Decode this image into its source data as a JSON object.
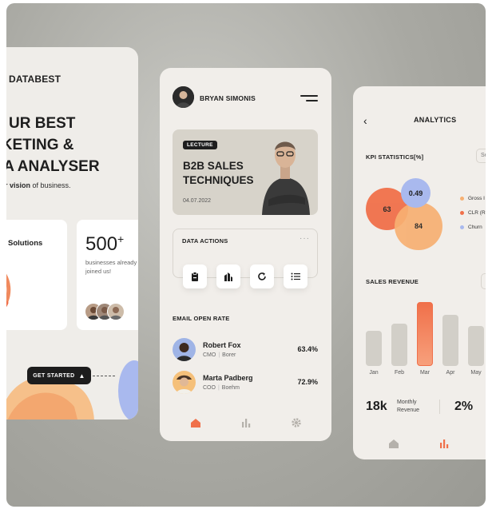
{
  "left": {
    "brand": "DATABEST",
    "headline": [
      "UR BEST",
      "RKETING &",
      "TA ANALYSER"
    ],
    "sub_bold": "ear vision",
    "sub_rest": " of business.",
    "box1_title": "Solutions",
    "count": "500",
    "count_sup": "+",
    "count_sub": "businesses already joined us!",
    "cta": "GET STARTED",
    "colors": {
      "accent": "#f0704a",
      "cta_bg": "#1d1d1d"
    }
  },
  "mid": {
    "user_name": "BRYAN SIMONIS",
    "banner": {
      "badge": "LECTURE",
      "title": "B2B SALES TECHNIQUES",
      "date": "04.07.2022"
    },
    "data_actions": {
      "title": "DATA ACTIONS",
      "more": "···",
      "icons": [
        "clipboard-icon",
        "building-icon",
        "refresh-icon",
        "list-icon"
      ]
    },
    "email_open_rate": {
      "title": "EMAIL OPEN RATE",
      "rows": [
        {
          "name": "Robert Fox",
          "role": "CMO",
          "company": "Borer",
          "rate": "63.4%"
        },
        {
          "name": "Marta Padberg",
          "role": "COO",
          "company": "Boehm",
          "rate": "72.9%"
        }
      ]
    },
    "nav": [
      "home-icon",
      "chart-icon",
      "settings-icon"
    ],
    "colors": {
      "active_nav": "#f0704a",
      "avatar1_bg": "#9fb4e6",
      "avatar2_bg": "#f5c07a"
    }
  },
  "right": {
    "title": "ANALYTICS",
    "kpi_title": "KPI STATISTICS[%]",
    "kpi_select": "Se",
    "bubbles": [
      {
        "label": "63",
        "color": "#f0704a"
      },
      {
        "label": "0.49",
        "color": "#a9b9ee"
      },
      {
        "label": "84",
        "color": "#f7b072"
      }
    ],
    "legend": [
      {
        "label": "Gross I",
        "color": "#f7b072"
      },
      {
        "label": "CLR (R",
        "color": "#f0704a"
      },
      {
        "label": "Churn",
        "color": "#a9b9ee"
      }
    ],
    "sales_title": "SALES REVENUE",
    "months": [
      "Jan",
      "Feb",
      "Mar",
      "Apr",
      "May"
    ],
    "bar_levels": [
      0.55,
      0.66,
      1.0,
      0.8,
      0.63
    ],
    "highlight_month": "Mar",
    "stat1": "18k",
    "stat1_label": "Monthly Revenue",
    "stat2": "2%",
    "nav": [
      "home-icon",
      "chart-icon",
      "user-icon"
    ]
  }
}
